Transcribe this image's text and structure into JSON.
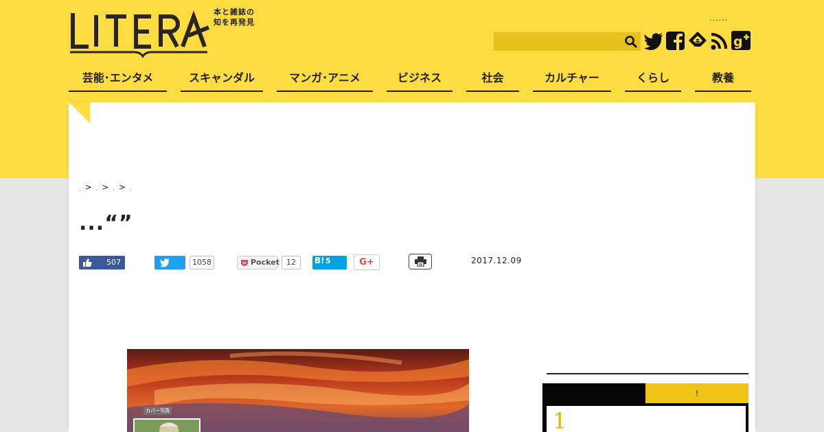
{
  "header": {
    "logo_text": "LITERA",
    "tagline_line1": "本と雑誌の",
    "tagline_line2": "知を再発見",
    "dots": "......",
    "search": {
      "placeholder": ""
    }
  },
  "social_icons": [
    "twitter-icon",
    "facebook-icon",
    "feedly-icon",
    "rss-icon",
    "google-plus-icon"
  ],
  "nav": {
    "items": [
      {
        "label": "芸能･エンタメ"
      },
      {
        "label": "スキャンダル"
      },
      {
        "label": "マンガ･アニメ"
      },
      {
        "label": "ビジネス"
      },
      {
        "label": "社会"
      },
      {
        "label": "カルチャー"
      },
      {
        "label": "くらし"
      },
      {
        "label": "教養"
      }
    ]
  },
  "breadcrumb": {
    "dot": ",",
    "sep": ">"
  },
  "article": {
    "title": "...“”",
    "date": "2017.12.09"
  },
  "share": {
    "facebook_count": "507",
    "twitter_count": "1058",
    "pocket_label": "Pocket",
    "pocket_count": "12",
    "hatena_label": "B!",
    "hatena_count": "5",
    "gplus_label": "G+"
  },
  "hero": {
    "caption": "カバー写真"
  },
  "sidebar": {
    "ranking_tab_b": "!",
    "rank_first": "1"
  },
  "colors": {
    "brand_yellow": "#fddc42",
    "facebook": "#3b5998",
    "twitter": "#1da1f2",
    "hatena": "#00a4de",
    "rank_gold": "#e0b400"
  }
}
